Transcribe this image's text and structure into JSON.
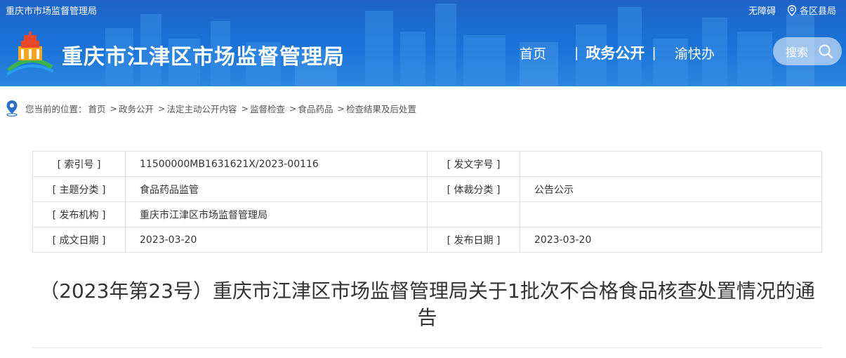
{
  "header": {
    "top_title": "重庆市市场监督管理局",
    "accessibility": "无障碍",
    "district_link": "各区县局",
    "site_title": "重庆市江津区市场监督管理局",
    "nav": [
      {
        "label": "首页"
      },
      {
        "label": "政务公开"
      },
      {
        "label": "渝快办"
      }
    ],
    "search_label": "搜索",
    "colors": {
      "banner": "#1a73d8",
      "search_bg": "#9ec4ee"
    }
  },
  "breadcrumb": {
    "prefix": "您当前的位置：",
    "items": [
      "首页",
      "政务公开",
      "法定主动公开内容",
      "监督检查",
      "食品药品",
      "检查结果及后处置"
    ],
    "separator": ">"
  },
  "meta": {
    "rows": [
      {
        "k1": "[ 索引号 ]",
        "v1": "11500000MB1631621X/2023-00116",
        "k2": "[ 发文字号 ]",
        "v2": ""
      },
      {
        "k1": "[ 主题分类 ]",
        "v1": "食品药品监管",
        "k2": "[ 体裁分类 ]",
        "v2": "公告公示"
      },
      {
        "k1": "[ 发布机构 ]",
        "v1": "重庆市江津区市场监督管理局",
        "k2": "",
        "v2": ""
      },
      {
        "k1": "[ 成文日期 ]",
        "v1": "2023-03-20",
        "k2": "[ 发布日期 ]",
        "v2": "2023-03-20"
      }
    ]
  },
  "article": {
    "title": "（2023年第23号）重庆市江津区市场监督管理局关于1批次不合格食品核查处置情况的通告"
  }
}
